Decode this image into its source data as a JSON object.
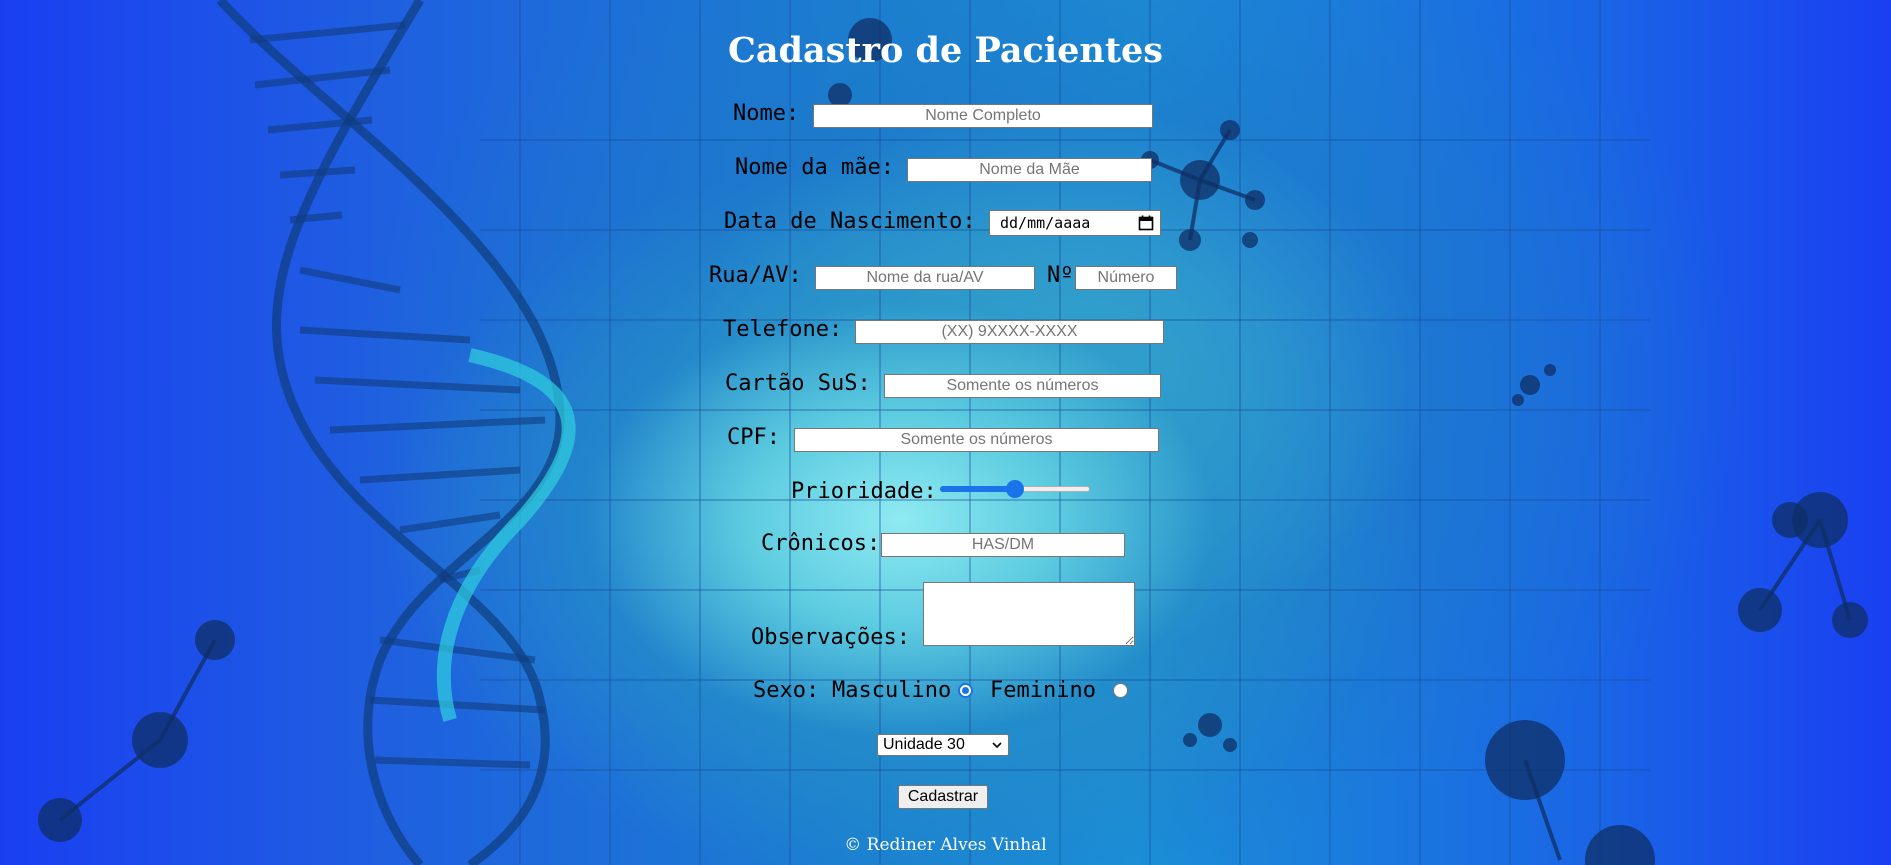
{
  "page": {
    "title": "Cadastro de Pacientes"
  },
  "form": {
    "nome": {
      "label": "Nome:",
      "placeholder": "Nome Completo"
    },
    "nome_mae": {
      "label": "Nome da mãe:",
      "placeholder": "Nome da Mãe"
    },
    "nascimento": {
      "label": "Data de Nascimento:",
      "value": "dd/mm/aaaa"
    },
    "rua": {
      "label": "Rua/AV:",
      "placeholder": "Nome da rua/AV"
    },
    "numero": {
      "label": "Nº",
      "placeholder": "Número"
    },
    "telefone": {
      "label": "Telefone:",
      "placeholder": "(XX) 9XXXX-XXXX"
    },
    "cartao_sus": {
      "label": "Cartão SuS:",
      "placeholder": "Somente os números"
    },
    "cpf": {
      "label": "CPF:",
      "placeholder": "Somente os números"
    },
    "prioridade": {
      "label": "Prioridade:",
      "value_fraction": 0.5
    },
    "cronicos": {
      "label": "Crônicos:",
      "placeholder": "HAS/DM"
    },
    "observacoes": {
      "label": "Observações:"
    },
    "sexo": {
      "label": "Sexo:",
      "options": [
        {
          "label": "Masculino",
          "checked": true
        },
        {
          "label": "Feminino",
          "checked": false
        }
      ]
    },
    "unidade": {
      "selected": "Unidade 30"
    },
    "submit_label": "Cadastrar"
  },
  "footer": {
    "text": "© Rediner Alves Vinhal"
  },
  "colors": {
    "accent": "#1a73e8",
    "title": "#ffffff",
    "background_edge": "#1a3ff2",
    "background_center": "#8feaf2"
  },
  "icons": {
    "date": "calendar-icon",
    "select": "chevron-down-icon"
  }
}
